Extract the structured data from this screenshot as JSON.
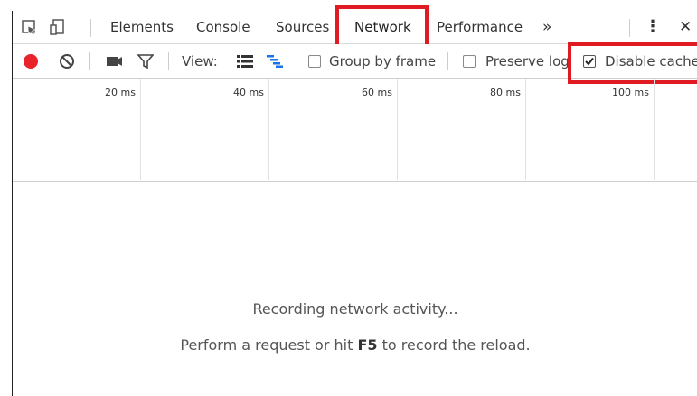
{
  "tabs": {
    "elements": "Elements",
    "console": "Console",
    "sources": "Sources",
    "network": "Network",
    "performance": "Performance",
    "more": "»",
    "menu": "⋮",
    "close": "✕"
  },
  "toolbar": {
    "view_label": "View:",
    "group_by_frame": "Group by frame",
    "preserve_log": "Preserve log",
    "disable_cache": "Disable cache",
    "disable_cache_checked": true,
    "preserve_log_checked": false,
    "group_by_frame_checked": false
  },
  "timeline": {
    "ticks": [
      "20 ms",
      "40 ms",
      "60 ms",
      "80 ms",
      "100 ms"
    ]
  },
  "empty_state": {
    "line1": "Recording network activity...",
    "line2_before": "Perform a request or hit ",
    "line2_key": "F5",
    "line2_after": " to record the reload."
  },
  "colors": {
    "record": "#e8232a",
    "highlight": "#e01a22",
    "accent_blue": "#1a73e8"
  }
}
